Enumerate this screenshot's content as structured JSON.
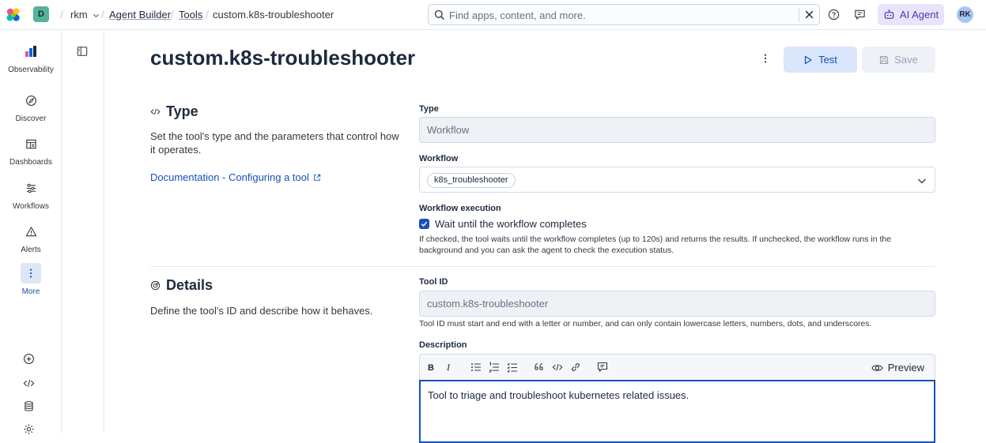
{
  "header": {
    "space_initial": "D",
    "breadcrumbs": {
      "space_name": "rkm",
      "agent_builder": "Agent Builder",
      "tools": "Tools",
      "current": "custom.k8s-troubleshooter"
    },
    "search": {
      "placeholder": "Find apps, content, and more.",
      "value": ""
    },
    "ai_agent_label": "AI Agent",
    "avatar_initials": "RK",
    "colors": {
      "ai_agent_bg": "#e8e4fb",
      "avatar_bg": "#a8c6f0"
    }
  },
  "leftnav": {
    "items": [
      {
        "label": "Observability",
        "icon": "observability-icon"
      },
      {
        "label": "Discover",
        "icon": "discover-icon"
      },
      {
        "label": "Dashboards",
        "icon": "dashboards-icon"
      },
      {
        "label": "Workflows",
        "icon": "workflows-icon"
      },
      {
        "label": "Alerts",
        "icon": "alerts-icon"
      },
      {
        "label": "More",
        "icon": "more-icon"
      }
    ],
    "active": "More"
  },
  "page": {
    "title": "custom.k8s-troubleshooter",
    "test_label": "Test",
    "save_label": "Save"
  },
  "type_section": {
    "title": "Type",
    "description": "Set the tool's type and the parameters that control how it operates.",
    "doc_link": "Documentation - Configuring a tool",
    "type_label": "Type",
    "type_value": "Workflow",
    "workflow_label": "Workflow",
    "workflow_value": "k8s_troubleshooter",
    "execution_label": "Workflow execution",
    "execution_checkbox_label": "Wait until the workflow completes",
    "execution_checked": true,
    "execution_help": "If checked, the tool waits until the workflow completes (up to 120s) and returns the results. If unchecked, the workflow runs in the background and you can ask the agent to check the execution status."
  },
  "details_section": {
    "title": "Details",
    "description": "Define the tool's ID and describe how it behaves.",
    "tool_id_label": "Tool ID",
    "tool_id_value": "custom.k8s-troubleshooter",
    "tool_id_help": "Tool ID must start and end with a letter or number, and can only contain lowercase letters, numbers, dots, and underscores.",
    "description_label": "Description",
    "preview_label": "Preview",
    "description_value": "Tool to triage and troubleshoot kubernetes related issues."
  },
  "colors": {
    "primary": "#1750ba",
    "test_button_bg": "#d9e6fb",
    "save_button_bg": "#eef1f6",
    "readonly_field_bg": "#eef2f7"
  }
}
